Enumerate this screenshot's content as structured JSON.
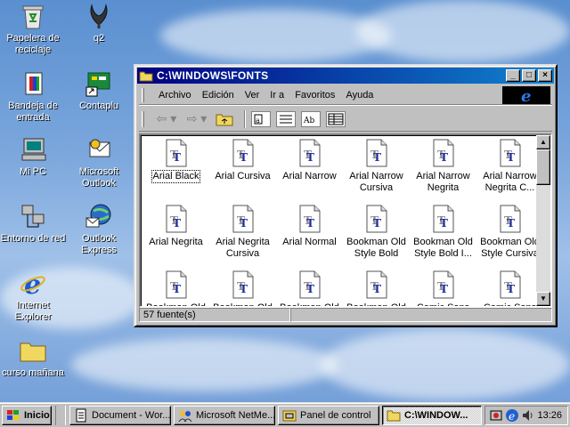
{
  "desktop": {
    "icons": [
      {
        "label": "Papelera de reciclaje",
        "icon": "recycle-bin-icon"
      },
      {
        "label": "q2",
        "icon": "quake-icon"
      },
      {
        "label": "Bandeja de entrada",
        "icon": "inbox-icon"
      },
      {
        "label": "Contaplu",
        "icon": "app-shortcut-icon"
      },
      {
        "label": "Mi PC",
        "icon": "my-computer-icon"
      },
      {
        "label": "Microsoft Outlook",
        "icon": "outlook-icon"
      },
      {
        "label": "Entorno de red",
        "icon": "network-neighborhood-icon"
      },
      {
        "label": "Outlook Express",
        "icon": "outlook-express-icon"
      },
      {
        "label": "Internet Explorer",
        "icon": "internet-explorer-icon"
      },
      {
        "label": "curso mañana",
        "icon": "folder-icon"
      }
    ]
  },
  "window": {
    "title": "C:\\WINDOWS\\FONTS",
    "menu": [
      "Archivo",
      "Edición",
      "Ver",
      "Ir a",
      "Favoritos",
      "Ayuda"
    ],
    "status": "57 fuente(s)",
    "fonts": [
      "Arial Black",
      "Arial Cursiva",
      "Arial Narrow",
      "Arial Narrow Cursiva",
      "Arial Narrow Negrita",
      "Arial Narrow Negrita C...",
      "Arial Negrita",
      "Arial Negrita Cursiva",
      "Arial Normal",
      "Bookman Old Style Bold",
      "Bookman Old Style Bold I...",
      "Bookman Old Style Cursiva",
      "Bookman Old",
      "Bookman Old",
      "Bookman Old",
      "Bookman Old",
      "Comic Sans",
      "Comic Sans"
    ]
  },
  "taskbar": {
    "start_label": "Inicio",
    "tasks": [
      {
        "label": "Document - Wor...",
        "active": false
      },
      {
        "label": "Microsoft NetMe...",
        "active": false
      },
      {
        "label": "Panel de control",
        "active": false
      },
      {
        "label": "C:\\WINDOW...",
        "active": true
      }
    ],
    "clock": "13:26"
  }
}
